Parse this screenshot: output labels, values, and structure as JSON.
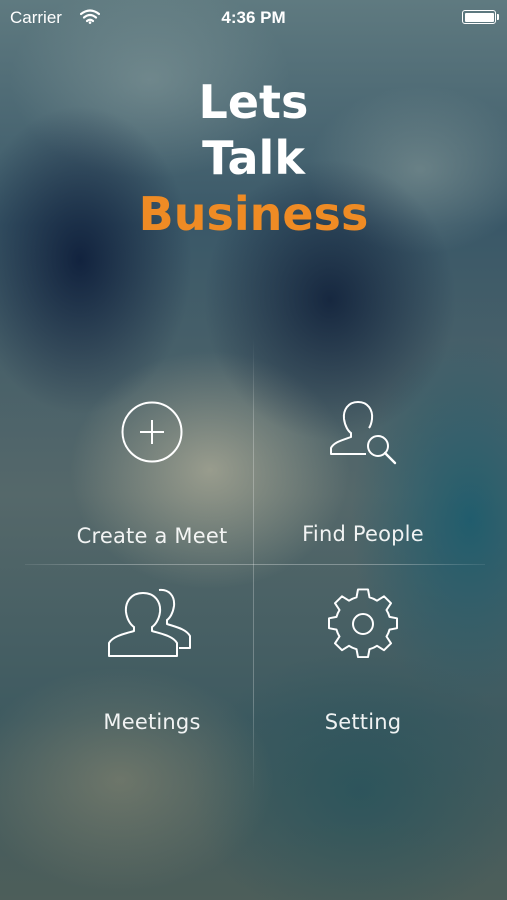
{
  "status_bar": {
    "carrier": "Carrier",
    "time": "4:36 PM",
    "battery_level": 1.0
  },
  "logo": {
    "line1": "Lets",
    "line2": "Talk",
    "line3": "Business",
    "accent_color": "#ef8b24"
  },
  "menu": {
    "items": [
      {
        "label": "Create a Meet",
        "icon": "plus-circle-icon"
      },
      {
        "label": "Find People",
        "icon": "person-search-icon"
      },
      {
        "label": "Meetings",
        "icon": "people-icon"
      },
      {
        "label": "Setting",
        "icon": "gear-icon"
      }
    ]
  }
}
